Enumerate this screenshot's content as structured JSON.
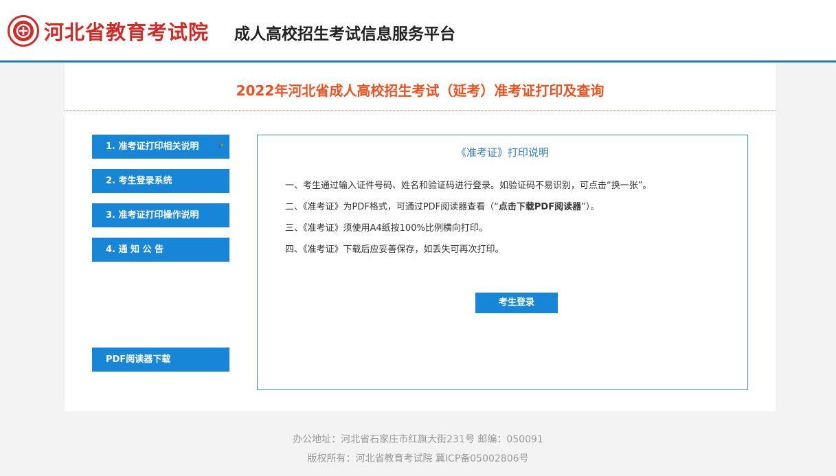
{
  "header": {
    "brand_name": "河北省教育考试院",
    "platform_name": "成人高校招生考试信息服务平台",
    "brand_color": "#d22a25",
    "accent_color": "#1e78c8"
  },
  "page": {
    "title": "2022年河北省成人高校招生考试（延考）准考证打印及查询"
  },
  "sidebar": {
    "items": [
      {
        "label": "1. 准考证打印相关说明"
      },
      {
        "label": "2. 考生登录系统"
      },
      {
        "label": "3. 准考证打印操作说明"
      },
      {
        "label": "4. 通 知 公 告"
      }
    ],
    "pdf_download": {
      "label": "PDF阅读器下载"
    },
    "button_color": "#1786d6"
  },
  "panel": {
    "title": "《准考证》打印说明",
    "instructions": [
      {
        "text": "一、考生通过输入证件号码、姓名和验证码进行登录。如验证码不易识别，可点击“换一张”。"
      },
      {
        "prefix": "二、《准考证》为PDF格式，可通过PDF阅读器查看（“",
        "link": "点击下载PDF阅读器",
        "suffix": "”）。"
      },
      {
        "text": "三、《准考证》须使用A4纸按100%比例横向打印。"
      },
      {
        "text": "四、《准考证》下载后应妥善保存，如丢失可再次打印。"
      }
    ],
    "login_button": "考生登录"
  },
  "footer": {
    "address": "办公地址：河北省石家庄市红旗大街231号    邮编：050091",
    "copyright": "版权所有：河北省教育考试院 冀ICP备05002806号"
  }
}
